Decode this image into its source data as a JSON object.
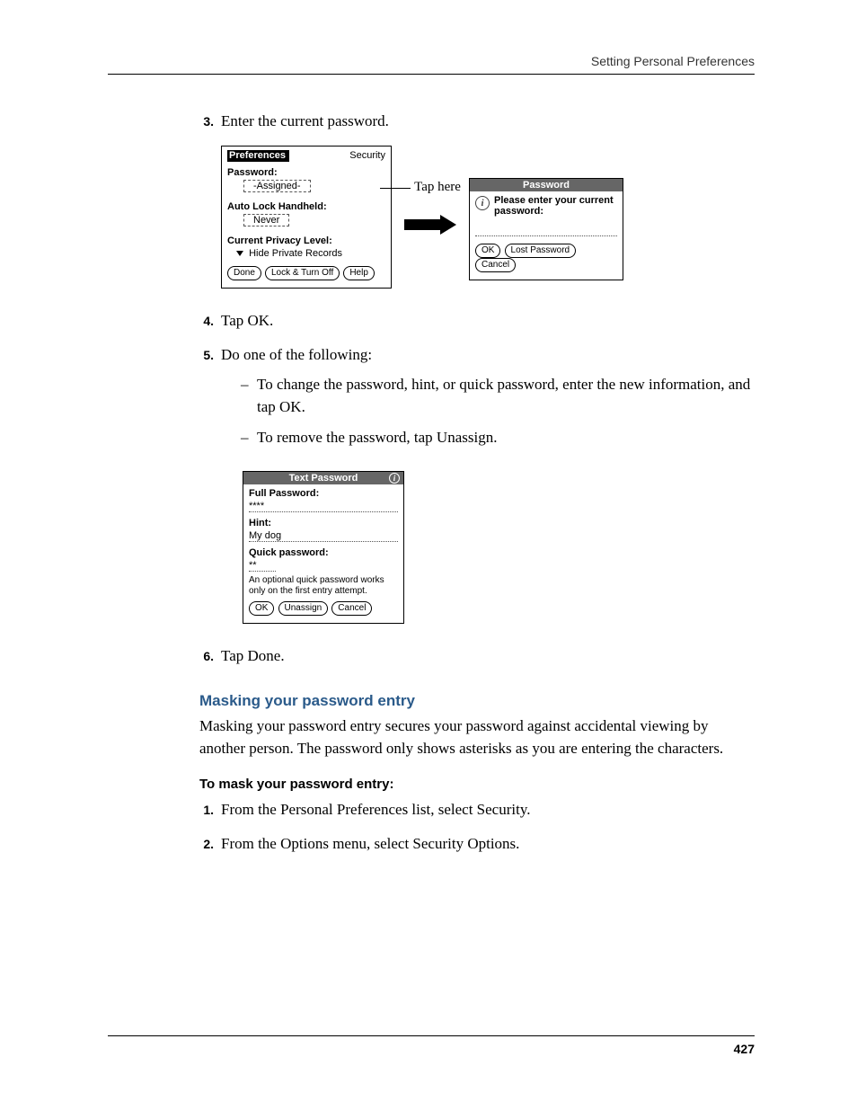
{
  "running_head": "Setting Personal Preferences",
  "page_number": "427",
  "steps": {
    "s3": {
      "num": "3.",
      "text": "Enter the current password."
    },
    "s4": {
      "num": "4.",
      "text": "Tap OK."
    },
    "s5": {
      "num": "5.",
      "text": "Do one of the following:"
    },
    "s5a": "To change the password, hint, or quick password, enter the new information, and tap OK.",
    "s5b": "To remove the password, tap Unassign.",
    "s6": {
      "num": "6.",
      "text": "Tap Done."
    }
  },
  "fig1": {
    "prefs": {
      "title": "Preferences",
      "category": "Security",
      "password_label": "Password:",
      "password_value": "-Assigned-",
      "autolock_label": "Auto Lock Handheld:",
      "autolock_value": "Never",
      "privacy_label": "Current Privacy Level:",
      "privacy_value": "Hide Private Records",
      "btn_done": "Done",
      "btn_lock": "Lock & Turn Off",
      "btn_help": "Help"
    },
    "tap_here": "Tap here",
    "pwd_dialog": {
      "title": "Password",
      "prompt": "Please enter your current password:",
      "btn_ok": "OK",
      "btn_lost": "Lost Password",
      "btn_cancel": "Cancel"
    }
  },
  "fig2": {
    "title": "Text Password",
    "full_label": "Full Password:",
    "full_value": "****",
    "hint_label": "Hint:",
    "hint_value": "My dog",
    "quick_label": "Quick password:",
    "quick_value": "**",
    "note": "An optional quick password works only on the first entry attempt.",
    "btn_ok": "OK",
    "btn_unassign": "Unassign",
    "btn_cancel": "Cancel"
  },
  "section": {
    "heading": "Masking your password entry",
    "para": "Masking your password entry secures your password against accidental viewing by another person. The password only shows asterisks as you are entering the characters.",
    "task_heading": "To mask your password entry:",
    "t1": {
      "num": "1.",
      "text": "From the Personal Preferences list, select Security."
    },
    "t2": {
      "num": "2.",
      "text": "From the Options menu, select Security Options."
    }
  }
}
